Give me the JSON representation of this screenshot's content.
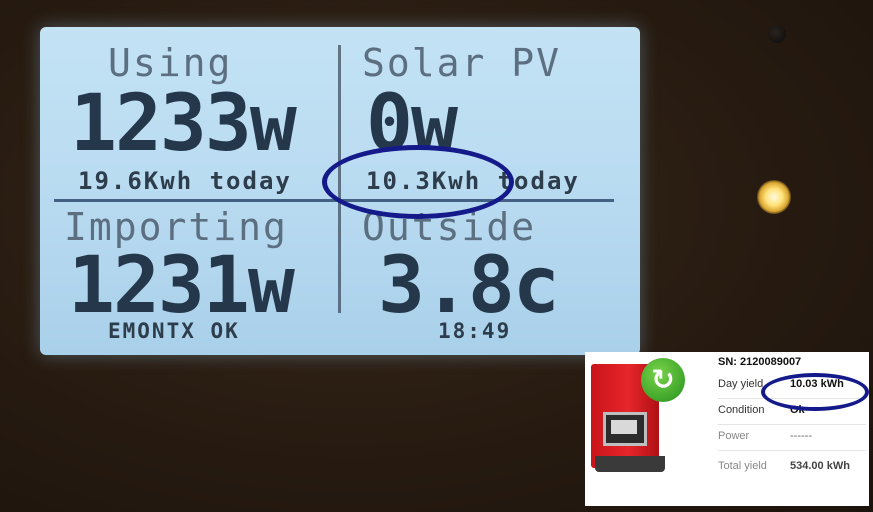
{
  "lcd": {
    "using": {
      "label": "Using",
      "value": "1233w",
      "today": "19.6Kwh today"
    },
    "solar": {
      "label": "Solar PV",
      "value": "0w",
      "today": "10.3Kwh today"
    },
    "importing": {
      "label": "Importing",
      "value": "1231w",
      "status": "EMONTX OK"
    },
    "outside": {
      "label": "Outside",
      "value": "3.8c",
      "time": "18:49"
    }
  },
  "inverter_panel": {
    "serial": "SN: 2120089007",
    "rows": [
      {
        "label": "Day yield",
        "value": "10.03  kWh"
      },
      {
        "label": "Condition",
        "value": "Ok"
      },
      {
        "label": "Power",
        "value": "------"
      },
      {
        "label": "Total yield",
        "value": "534.00  kWh"
      }
    ]
  },
  "colors": {
    "lcd_bg": "#b9dbf1",
    "highlight_oval": "#141a8a",
    "inverter_red": "#e6262a"
  }
}
